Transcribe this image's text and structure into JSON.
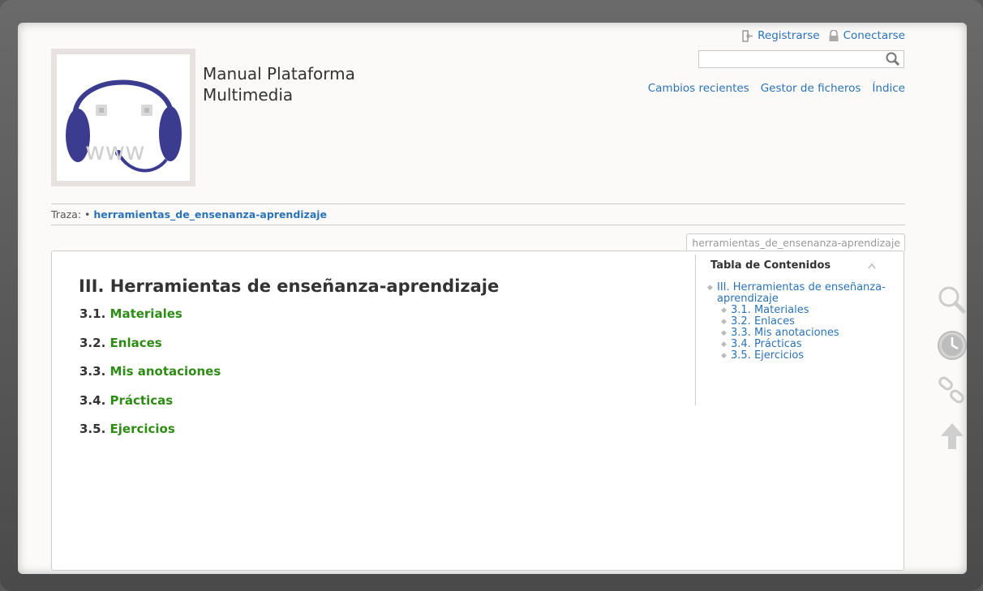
{
  "site": {
    "title": "Manual Plataforma Multimedia"
  },
  "usertools": {
    "register": "Registrarse",
    "login": "Conectarse"
  },
  "search": {
    "value": "",
    "placeholder": ""
  },
  "sitetools": {
    "recent": "Cambios recientes",
    "media": "Gestor de ficheros",
    "index": "Índice"
  },
  "breadcrumb": {
    "label": "Traza:",
    "bullet": "•",
    "link": "herramientas_de_ensenanza-aprendizaje"
  },
  "pageid": "herramientas_de_ensenanza-aprendizaje",
  "content": {
    "heading": "III. Herramientas de enseñanza-aprendizaje",
    "sections": [
      {
        "num": "3.1.",
        "title": "Materiales"
      },
      {
        "num": "3.2.",
        "title": "Enlaces"
      },
      {
        "num": "3.3.",
        "title": "Mis anotaciones"
      },
      {
        "num": "3.4.",
        "title": "Prácticas"
      },
      {
        "num": "3.5.",
        "title": "Ejercicios"
      }
    ]
  },
  "toc": {
    "title": "Tabla de Contenidos",
    "top": "III. Herramientas de enseñanza-aprendizaje",
    "items": [
      "3.1. Materiales",
      "3.2. Enlaces",
      "3.3. Mis anotaciones",
      "3.4. Prácticas",
      "3.5. Ejercicios"
    ]
  },
  "logo": {
    "text": "www"
  },
  "colors": {
    "link": "#2b73b7",
    "section_link": "#2e8b15",
    "logo_blue": "#3b3c8f"
  },
  "icons": [
    "login-icon",
    "lock-icon",
    "search-icon",
    "magnifier-icon",
    "clock-icon",
    "link-icon",
    "arrow-up-icon"
  ]
}
